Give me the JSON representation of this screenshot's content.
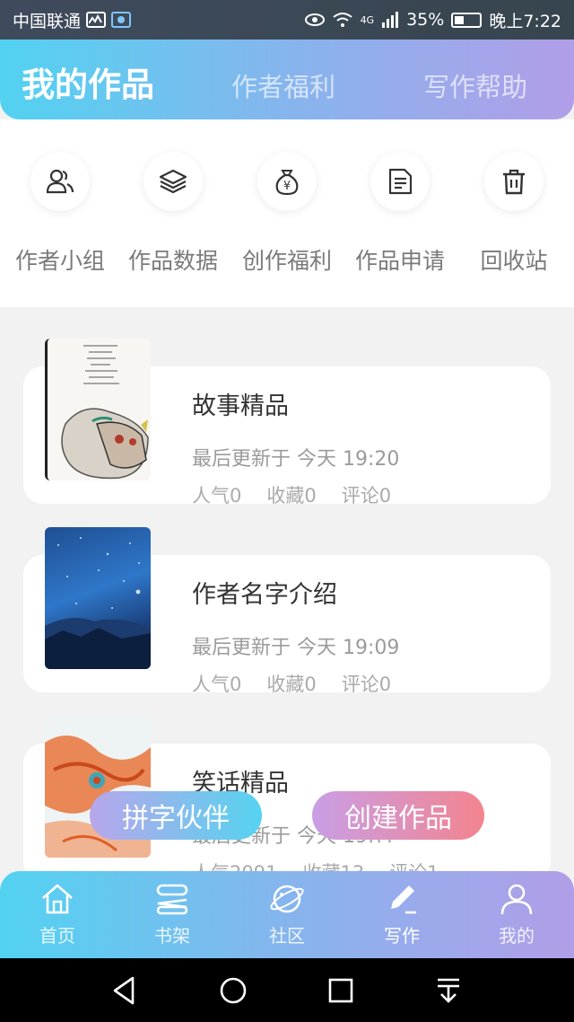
{
  "status_bar": {
    "carrier": "中国联通",
    "battery": "35%",
    "time": "晚上7:22",
    "signal_label": "4G"
  },
  "header": {
    "tabs": [
      {
        "label": "我的作品",
        "active": true
      },
      {
        "label": "作者福利",
        "active": false
      },
      {
        "label": "写作帮助",
        "active": false
      }
    ]
  },
  "actions": [
    {
      "label": "作者小组",
      "icon": "group-icon"
    },
    {
      "label": "作品数据",
      "icon": "layers-icon"
    },
    {
      "label": "创作福利",
      "icon": "money-bag-icon"
    },
    {
      "label": "作品申请",
      "icon": "document-icon"
    },
    {
      "label": "回收站",
      "icon": "trash-icon"
    }
  ],
  "works": [
    {
      "title": "故事精品",
      "updated": "最后更新于 今天 19:20",
      "popularity": "人气0",
      "favorites": "收藏0",
      "comments": "评论0",
      "cover": "illustration-cover"
    },
    {
      "title": "作者名字介绍",
      "updated": "最后更新于 今天 19:09",
      "popularity": "人气0",
      "favorites": "收藏0",
      "comments": "评论0",
      "cover": "starry-sky-cover"
    },
    {
      "title": "笑话精品",
      "updated": "最后更新于 今天 19:??",
      "popularity": "人气2091",
      "favorites": "收藏13",
      "comments": "评论1",
      "cover": "abstract-cover"
    }
  ],
  "floating_buttons": {
    "partner": "拼字伙伴",
    "create": "创建作品"
  },
  "bottom_nav": [
    {
      "label": "首页",
      "icon": "home-icon"
    },
    {
      "label": "书架",
      "icon": "bookshelf-icon"
    },
    {
      "label": "社区",
      "icon": "planet-icon"
    },
    {
      "label": "写作",
      "icon": "pen-icon",
      "active": true
    },
    {
      "label": "我的",
      "icon": "user-icon"
    }
  ],
  "colors": {
    "gradient_start": "#52d2f0",
    "gradient_end": "#b19ee8",
    "create_end": "#f3848f"
  }
}
